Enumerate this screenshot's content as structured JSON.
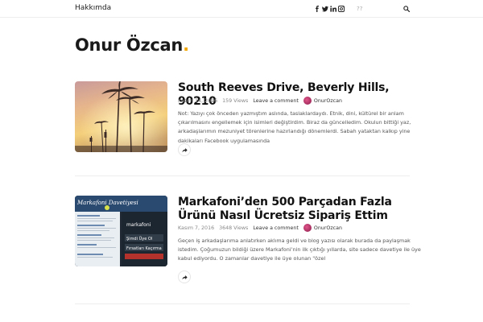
{
  "header": {
    "nav_label": "Hakkımda",
    "social_icons": [
      "facebook-icon",
      "twitter-icon",
      "linkedin-icon",
      "instagram-icon"
    ],
    "search_placeholder": "??"
  },
  "site": {
    "title": "Onur Özcan",
    "title_dot": ".",
    "accent_color": "#f2a700"
  },
  "posts": [
    {
      "title": "South Reeves Drive, Beverly Hills, 90210",
      "date": "Kasım 14, 2016",
      "views": "159 Views",
      "comment": "Leave a comment",
      "author": "OnurOzcan",
      "excerpt": "Not: Yazıyı çok önceden yazmıştım aslında, taslaklardaydı. Etnik, dini, kültürel bir anlam çıkarılmasını engellemek için isimleri değiştirdim. Biraz da güncelledim. Okulun bittiği yaz, arkadaşlarımın mezuniyet törenlerine hazırlandığı dönemlerdi. Sabah yataktan kalkıp yine dakikaları Facebook uygulamasında"
    },
    {
      "title": "Markafoni’den 500 Parçadan Fazla Ürünü Nasıl Ücretsiz Sipariş Ettim",
      "date": "Kasım 7, 2016",
      "views": "3648 Views",
      "comment": "Leave a comment",
      "author": "OnurOzcan",
      "excerpt": "Geçen iş arkadaşlarıma anlatırken aklıma geldi ve blog yazısı olarak burada da paylaşmak istedim. Çoğumuzun bildiği üzere Markafoni’nin ilk çıktığı yıllarda, site sadece davetiye ile üye kabul ediyordu. O zamanlar davetiye ile üye olunan \"özel",
      "thumb_text": {
        "headline": "Markafoni Davetiyesi",
        "brand": "markafoni",
        "sub1": "Şimdi Üye Ol",
        "sub2": "Fırsatları Kaçırma"
      }
    }
  ]
}
